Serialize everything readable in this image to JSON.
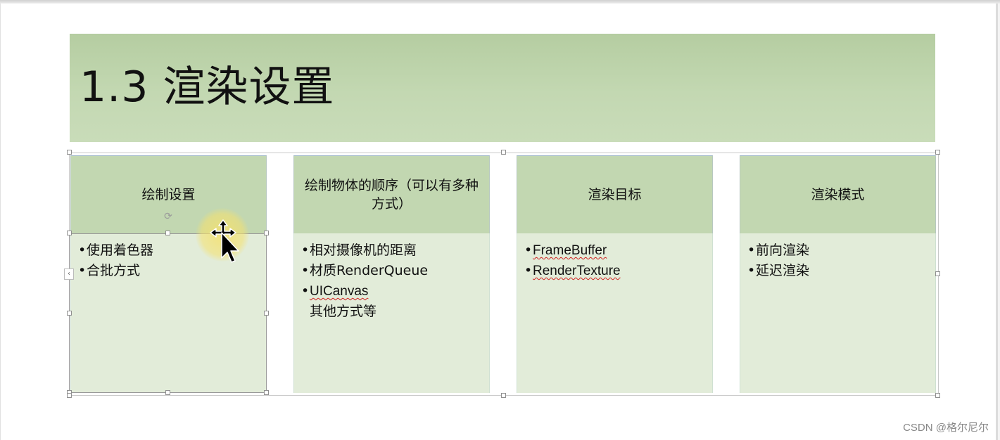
{
  "slide": {
    "title": "1.3 渲染设置",
    "columns": [
      {
        "header": "绘制设置",
        "items": [
          "使用着色器",
          "合批方式"
        ],
        "extra": ""
      },
      {
        "header": "绘制物体的顺序（可以有多种方式）",
        "items": [
          "相对摄像机的距离",
          "材质RenderQueue",
          "UICanvas"
        ],
        "extra": "其他方式等"
      },
      {
        "header": "渲染目标",
        "items": [
          "FrameBuffer",
          "RenderTexture"
        ],
        "extra": ""
      },
      {
        "header": "渲染模式",
        "items": [
          "前向渲染",
          "延迟渲染"
        ],
        "extra": ""
      }
    ]
  },
  "watermark": "CSDN @格尔尼尔",
  "icons": {
    "cursor": "move-cursor-icon",
    "rotate": "rotate-handle-icon"
  },
  "colors": {
    "title_band": "#c3d8b2",
    "header": "#c2d7b1",
    "body": "#e2ecd9",
    "cursor_highlight": "#f5e16e",
    "spell_underline": "#d02020"
  }
}
